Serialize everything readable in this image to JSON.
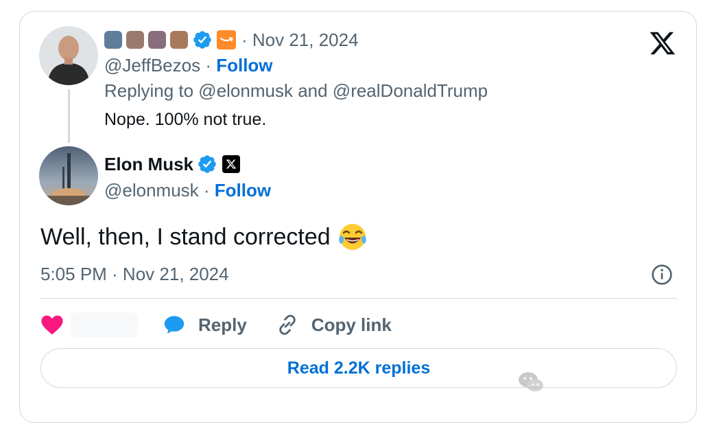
{
  "parent_tweet": {
    "date": "· Nov 21, 2024",
    "handle": "@JeffBezos",
    "separator": " · ",
    "follow_label": "Follow",
    "replying_to": "Replying to @elonmusk and @realDonaldTrump",
    "text": "Nope. 100% not true."
  },
  "main_tweet": {
    "author_name": "Elon Musk",
    "handle": "@elonmusk",
    "separator": " · ",
    "follow_label": "Follow",
    "text": "Well, then, I stand corrected",
    "emoji": "face-with-tears-of-joy",
    "timestamp": "5:05 PM · Nov 21, 2024"
  },
  "actions": {
    "reply_label": "Reply",
    "copy_link_label": "Copy link",
    "read_replies_label": "Read 2.2K replies"
  },
  "colors": {
    "accent_blue": "#006fd6",
    "secondary_text": "#536471",
    "like_pink": "#f91880",
    "verified_blue": "#1d9bf0",
    "border": "#cfd9de"
  },
  "icons": [
    "x-logo-icon",
    "verified-icon",
    "amazon-badge-icon",
    "x-affiliate-icon",
    "info-icon",
    "heart-icon",
    "reply-bubble-icon",
    "link-icon"
  ]
}
